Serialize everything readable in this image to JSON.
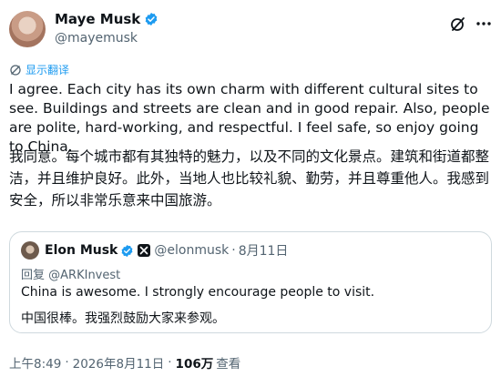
{
  "author": {
    "display_name": "Maye Musk",
    "handle": "@mayemusk"
  },
  "translate_label": "显示翻译",
  "tweet": {
    "text_en": "I agree. Each city has its own charm with different cultural sites to see. Buildings and streets are clean and in good repair. Also, people are polite, hard-working, and respectful. I feel safe, so enjoy going to China.",
    "text_zh": "我同意。每个城市都有其独特的魅力，以及不同的文化景点。建筑和街道都整洁，并且维护良好。此外，当地人也比较礼貌、勤劳，并且尊重他人。我感到安全，所以非常乐意来中国旅游。"
  },
  "quoted": {
    "display_name": "Elon Musk",
    "handle": "@elonmusk",
    "separator": "·",
    "time": "8月11日",
    "reply_prefix": "回复",
    "reply_to": "@ARKInvest",
    "text_en": "China is awesome. I strongly encourage people to visit.",
    "text_zh": "中国很棒。我强烈鼓励大家来参观。"
  },
  "meta": {
    "time": "上午8:49",
    "separator": "·",
    "date": "2026年8月11日",
    "views_count": "106万",
    "views_label": "查看"
  },
  "colors": {
    "accent": "#1d9bf0",
    "text": "#0f1419",
    "secondary": "#536471",
    "border": "#cfd9de"
  }
}
